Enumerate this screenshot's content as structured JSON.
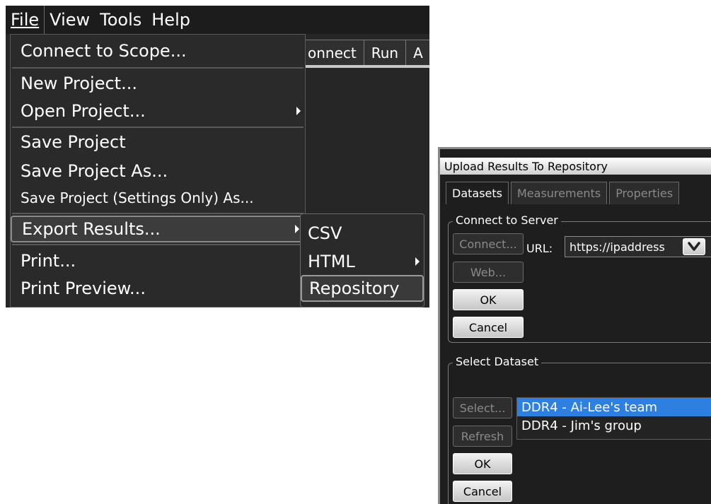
{
  "menubar": {
    "items": [
      {
        "label": "File"
      },
      {
        "label": "View"
      },
      {
        "label": "Tools"
      },
      {
        "label": "Help"
      }
    ]
  },
  "toolbar_tabs": [
    "onnect",
    "Run",
    "A"
  ],
  "file_menu": {
    "connect": "Connect to Scope...",
    "new_project": "New Project...",
    "open_project": "Open Project...",
    "save_project": "Save Project",
    "save_project_as": "Save Project As...",
    "save_settings_only": "Save Project (Settings Only) As...",
    "export_results": "Export Results...",
    "print": "Print...",
    "print_preview": "Print Preview..."
  },
  "export_submenu": {
    "csv": "CSV",
    "html": "HTML",
    "repository": "Repository"
  },
  "dialog": {
    "title": "Upload Results To Repository",
    "tabs": [
      "Datasets",
      "Measurements",
      "Properties"
    ],
    "active_tab": "Datasets",
    "connect_group": {
      "legend": "Connect to Server",
      "connect_button": "Connect...",
      "url_label": "URL:",
      "url_value": "https://ipaddress",
      "web_button": "Web...",
      "ok_button": "OK",
      "cancel_button": "Cancel"
    },
    "select_group": {
      "legend": "Select Dataset",
      "select_button": "Select...",
      "refresh_button": "Refresh",
      "ok_button": "OK",
      "cancel_button": "Cancel",
      "datasets": [
        "DDR4 - Ai-Lee's team",
        "DDR4 - Jim's group"
      ],
      "selected_index": 0
    }
  },
  "colors": {
    "selection": "#2d7fe0",
    "menu_bg": "#2a2a2a",
    "dialog_bg": "#1e1e1e"
  }
}
